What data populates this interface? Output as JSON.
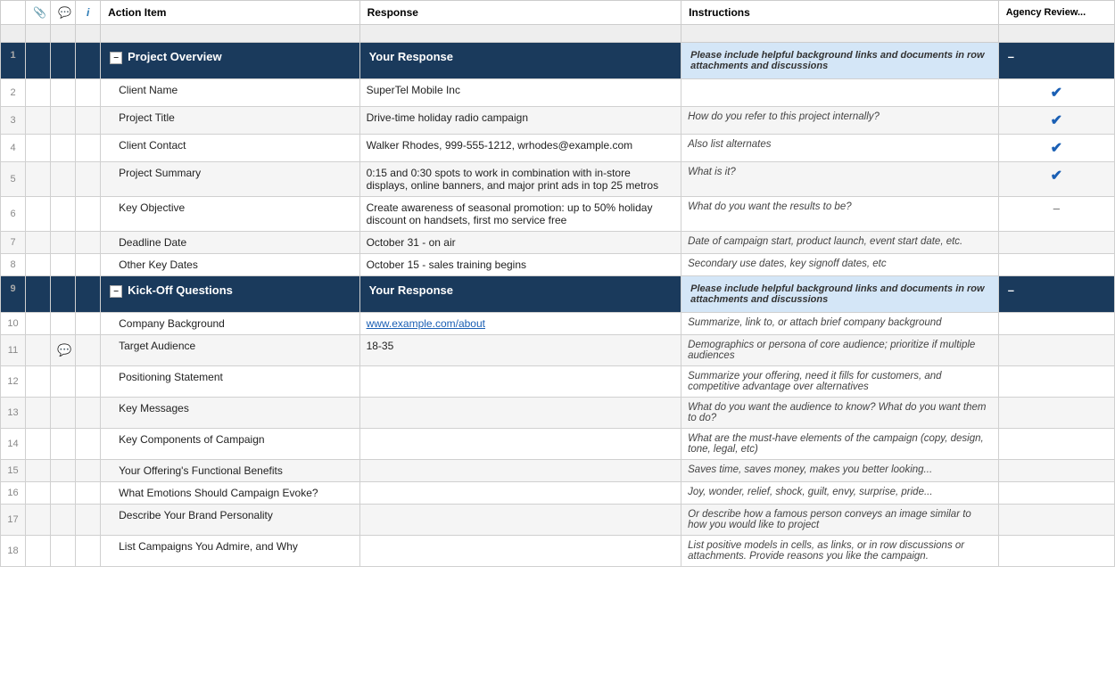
{
  "header": {
    "col_num": "",
    "col_attach_icon": "📎",
    "col_comment_icon": "💬",
    "col_info_icon": "i",
    "col_action": "Action Item",
    "col_response": "Response",
    "col_instructions": "Instructions",
    "col_agency": "Agency Review..."
  },
  "sections": [
    {
      "id": "project-overview",
      "row_num": 1,
      "label": "Project Overview",
      "response_header": "Your Response",
      "instructions_note": "Please include helpful background links and documents in row attachments and discussions",
      "agency_val": "–",
      "rows": [
        {
          "num": 2,
          "action": "Client Name",
          "response": "SuperTel Mobile Inc",
          "instructions": "",
          "agency": "✔"
        },
        {
          "num": 3,
          "action": "Project Title",
          "response": "Drive-time holiday radio campaign",
          "instructions": "How do you refer to this project internally?",
          "agency": "✔"
        },
        {
          "num": 4,
          "action": "Client Contact",
          "response": "Walker Rhodes, 999-555-1212, wrhodes@example.com",
          "instructions": "Also list alternates",
          "agency": "✔"
        },
        {
          "num": 5,
          "action": "Project Summary",
          "response": "0:15 and 0:30 spots to work in combination with in-store displays, online banners, and major print ads in top 25 metros",
          "instructions": "What is it?",
          "agency": "✔"
        },
        {
          "num": 6,
          "action": "Key Objective",
          "response": "Create awareness of seasonal promotion: up to 50% holiday discount on handsets, first mo service free",
          "instructions": "What do you want the results to be?",
          "agency": "–"
        },
        {
          "num": 7,
          "action": "Deadline Date",
          "response": "October 31 - on air",
          "instructions": "Date of campaign start, product launch, event start date, etc.",
          "agency": ""
        },
        {
          "num": 8,
          "action": "Other Key Dates",
          "response": "October 15 - sales training begins",
          "instructions": "Secondary use dates, key signoff dates, etc",
          "agency": ""
        }
      ]
    },
    {
      "id": "kickoff-questions",
      "row_num": 9,
      "label": "Kick-Off Questions",
      "response_header": "Your Response",
      "instructions_note": "Please include helpful background links and documents in row attachments and discussions",
      "agency_val": "–",
      "rows": [
        {
          "num": 10,
          "action": "Company Background",
          "response": "www.example.com/about",
          "response_link": true,
          "instructions": "Summarize, link to, or attach brief company background",
          "agency": "",
          "has_comment": false
        },
        {
          "num": 11,
          "action": "Target Audience",
          "response": "18-35",
          "instructions": "Demographics or persona of core audience; prioritize if multiple audiences",
          "agency": "",
          "has_comment": true
        },
        {
          "num": 12,
          "action": "Positioning Statement",
          "response": "",
          "instructions": "Summarize your offering, need it fills for customers, and competitive advantage over alternatives",
          "agency": ""
        },
        {
          "num": 13,
          "action": "Key Messages",
          "response": "",
          "instructions": "What do you want the audience to know? What do you want them to do?",
          "agency": ""
        },
        {
          "num": 14,
          "action": "Key Components of Campaign",
          "response": "",
          "instructions": "What are the must-have elements of the campaign (copy, design, tone, legal, etc)",
          "agency": ""
        },
        {
          "num": 15,
          "action": "Your Offering's Functional Benefits",
          "response": "",
          "instructions": "Saves time, saves money, makes you better looking...",
          "agency": ""
        },
        {
          "num": 16,
          "action": "What Emotions Should Campaign Evoke?",
          "response": "",
          "instructions": "Joy, wonder, relief, shock, guilt, envy, surprise, pride...",
          "agency": ""
        },
        {
          "num": 17,
          "action": "Describe Your Brand Personality",
          "response": "",
          "instructions": "Or describe how a famous person conveys an image similar to how you would like to project",
          "agency": ""
        },
        {
          "num": 18,
          "action": "List Campaigns You Admire, and Why",
          "response": "",
          "instructions": "List positive models in cells, as links, or in row discussions or attachments. Provide reasons you like the campaign.",
          "agency": ""
        }
      ]
    }
  ]
}
